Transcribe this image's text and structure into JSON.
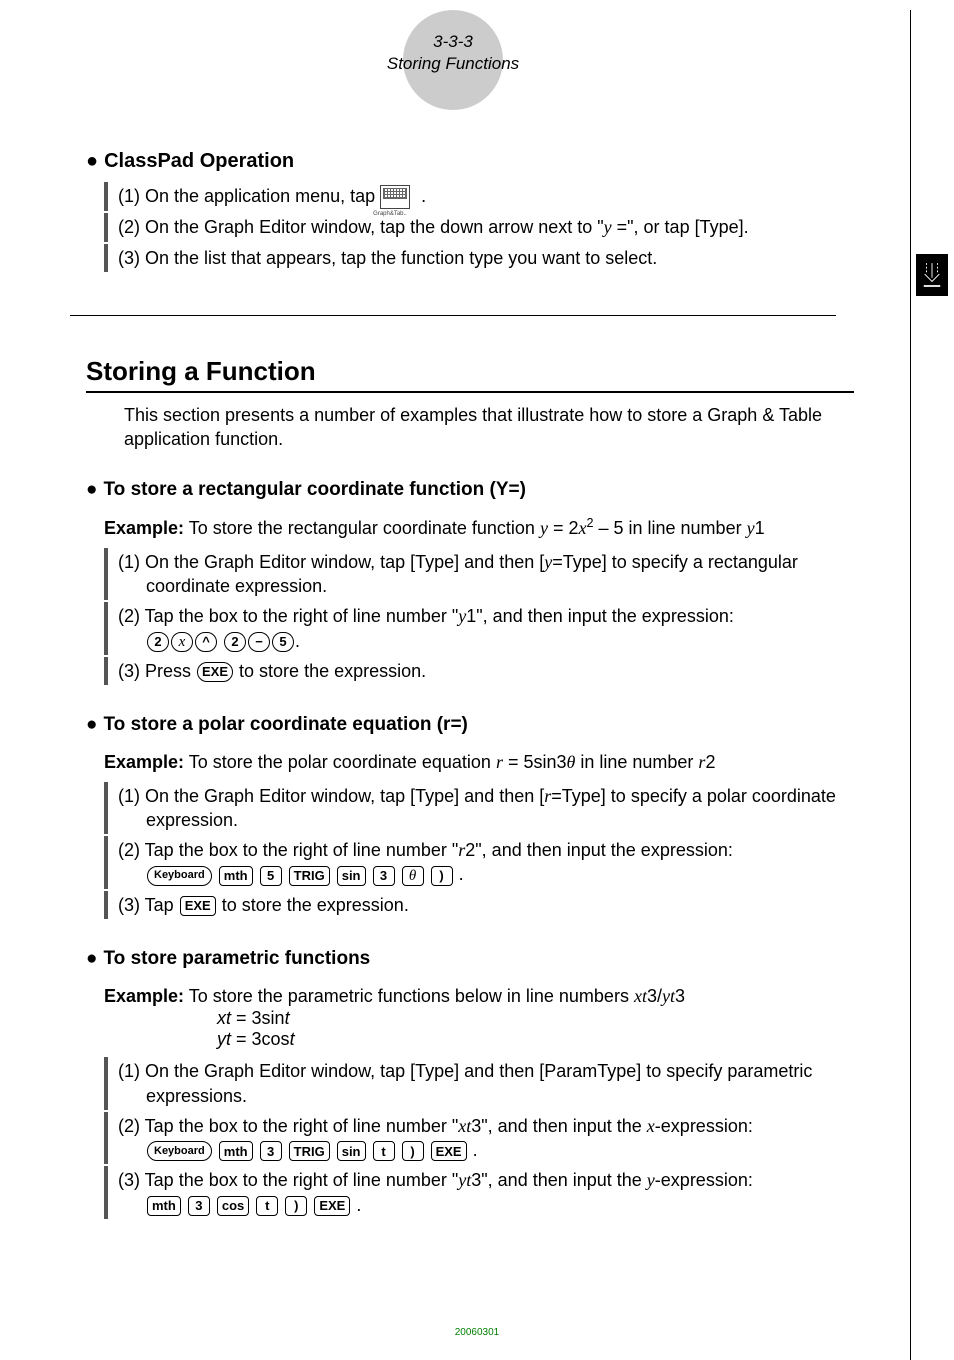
{
  "header": {
    "num": "3-3-3",
    "title": "Storing Functions"
  },
  "s1": {
    "title": "ClassPad Operation",
    "step1a": "(1) On the application menu, tap ",
    "step1b": ".",
    "app_icon_name": "graph-and-table-app-icon",
    "step2": "(2) On the Graph Editor window, tap the down arrow next to \"",
    "step2y": "y",
    "step2b": " =\", or tap [Type].",
    "step3": "(3) On the list that appears, tap the function type you want to select."
  },
  "h1": "Storing a Function",
  "intro": "This section presents a number of examples that illustrate how to store a Graph & Table application function.",
  "rect": {
    "title": "To store a rectangular coordinate function (Y=)",
    "ex_label": "Example:",
    "ex_a": "  To store the rectangular coordinate function ",
    "ex_eq_lhs": "y",
    "ex_eq_mid": " = 2",
    "ex_eq_x": "x",
    "ex_eq_sup": "2",
    "ex_eq_rhs": " – 5 in line number ",
    "ex_y1": "y",
    "ex_y1n": "1",
    "s1a": "(1) On the Graph Editor window, tap [Type] and then [",
    "s1y": "y",
    "s1b": "=Type] to specify a rectangular",
    "s1cont": "coordinate expression.",
    "s2a": "(2) Tap the box to the right of line number \"",
    "s2y": "y",
    "s2b": "1\", and then input the expression:",
    "s2keys": [
      "2",
      "x",
      "^",
      "2",
      "−",
      "5"
    ],
    "s2period": ".",
    "s3a": "(3) Press ",
    "s3key": "EXE",
    "s3b": " to store the expression."
  },
  "polar": {
    "title": "To store a polar coordinate equation (r=)",
    "ex_label": "Example:",
    "ex_a": "  To store the polar coordinate equation ",
    "ex_r": "r",
    "ex_mid": " = 5sin3",
    "ex_theta": "θ",
    "ex_b": " in line number ",
    "ex_rv": "r",
    "ex_rn": "2",
    "s1a": "(1) On the Graph Editor window, tap [Type] and then [",
    "s1r": "r",
    "s1b": "=Type] to specify a polar coordinate",
    "s1cont": "expression.",
    "s2a": "(2) Tap the box to the right of line number \"",
    "s2r": "r",
    "s2b": "2\", and then input the expression:",
    "s2keys": [
      "Keyboard",
      "mth",
      "5",
      "TRIG",
      "sin",
      "3",
      "θ",
      ")"
    ],
    "s2period": ".",
    "s3a": "(3) Tap ",
    "s3key": "EXE",
    "s3b": " to store the expression."
  },
  "param": {
    "title": "To store parametric functions",
    "ex_label": "Example:",
    "ex_a": "  To store the parametric functions below in line numbers ",
    "ex_xt": "xt",
    "ex_3a": "3/",
    "ex_yt": "yt",
    "ex_3b": "3",
    "eq1_l": "xt",
    "eq1_r": " = 3sin",
    "eq1_t": "t",
    "eq2_l": "yt",
    "eq2_r": " = 3cos",
    "eq2_t": "t",
    "s1": "(1) On the Graph Editor window, tap [Type] and then [ParamType] to specify parametric",
    "s1cont": "expressions.",
    "s2a": "(2) Tap the box to the right of line number \"",
    "s2xt": "xt",
    "s2b": "3\", and then input the ",
    "s2x": "x",
    "s2c": "-expression:",
    "s2keys": [
      "Keyboard",
      "mth",
      "3",
      "TRIG",
      "sin",
      "t",
      ")",
      "EXE"
    ],
    "s2period": ".",
    "s3a": "(3) Tap the box to the right of line number \"",
    "s3yt": "yt",
    "s3b": "3\", and then input the ",
    "s3y": "y",
    "s3c": "-expression:",
    "s3keys": [
      "mth",
      "3",
      "cos",
      "t",
      ")",
      "EXE"
    ],
    "s3period": "."
  },
  "pagenum": "20060301"
}
